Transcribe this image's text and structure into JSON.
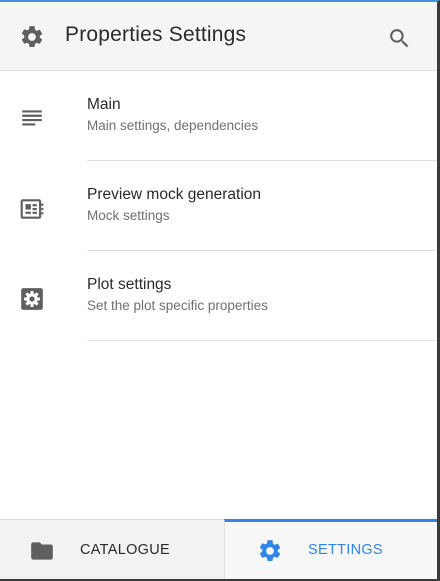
{
  "header": {
    "title": "Properties Settings",
    "left_icon": "gear-icon",
    "right_icon": "search-icon"
  },
  "items": [
    {
      "label": "Main",
      "sub": "Main settings, dependencies",
      "icon": "lines-icon"
    },
    {
      "label": "Preview mock generation",
      "sub": "Mock settings",
      "icon": "preview-icon"
    },
    {
      "label": "Plot settings",
      "sub": "Set the plot specific properties",
      "icon": "settings-box-icon"
    }
  ],
  "tabs": [
    {
      "label": "CATALOGUE",
      "icon": "folder-icon",
      "active": false
    },
    {
      "label": "SETTINGS",
      "icon": "gear-icon",
      "active": true
    }
  ],
  "colors": {
    "accent": "#2f86e8",
    "header_bg": "#f5f5f5",
    "icon": "#5f5f5f"
  }
}
